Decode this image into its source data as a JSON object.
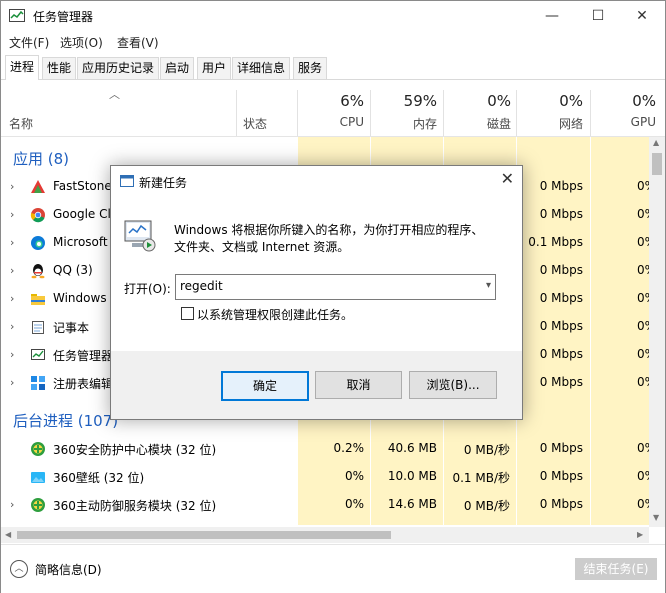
{
  "window": {
    "title": "任务管理器",
    "min": "—",
    "max": "☐",
    "close": "✕"
  },
  "menu": [
    "文件(F)",
    "选项(O)",
    "查看(V)"
  ],
  "tabs": [
    "进程",
    "性能",
    "应用历史记录",
    "启动",
    "用户",
    "详细信息",
    "服务"
  ],
  "columns": {
    "name": "名称",
    "status": "状态",
    "cpu": {
      "pct": "6%",
      "label": "CPU"
    },
    "mem": {
      "pct": "59%",
      "label": "内存"
    },
    "disk": {
      "pct": "0%",
      "label": "磁盘"
    },
    "net": {
      "pct": "0%",
      "label": "网络"
    },
    "gpu": {
      "pct": "0%",
      "label": "GPU"
    }
  },
  "groups": {
    "apps": "应用 (8)",
    "background": "后台进程 (107)"
  },
  "apps": [
    {
      "name": "FastStone",
      "net": "0 Mbps",
      "gpu": "0%",
      "icon": "faststone-icon"
    },
    {
      "name": "Google Cl",
      "net": "0 Mbps",
      "gpu": "0%",
      "icon": "chrome-icon"
    },
    {
      "name": "Microsoft",
      "net": "0.1 Mbps",
      "gpu": "0%",
      "icon": "edge-icon"
    },
    {
      "name": "QQ (3)",
      "net": "0 Mbps",
      "gpu": "0%",
      "icon": "qq-icon"
    },
    {
      "name": "Windows",
      "net": "0 Mbps",
      "gpu": "0%",
      "icon": "folder-icon"
    },
    {
      "name": "记事本",
      "net": "0 Mbps",
      "gpu": "0%",
      "icon": "notepad-icon"
    },
    {
      "name": "任务管理器",
      "net": "0 Mbps",
      "gpu": "0%",
      "icon": "taskmgr-icon"
    },
    {
      "name": "注册表编辑",
      "net": "0 Mbps",
      "gpu": "0%",
      "icon": "regedit-icon"
    }
  ],
  "background": [
    {
      "name": "360安全防护中心模块 (32 位)",
      "cpu": "0.2%",
      "mem": "40.6 MB",
      "disk": "0 MB/秒",
      "net": "0 Mbps",
      "gpu": "0%"
    },
    {
      "name": "360壁纸 (32 位)",
      "cpu": "0%",
      "mem": "10.0 MB",
      "disk": "0.1 MB/秒",
      "net": "0 Mbps",
      "gpu": "0%"
    },
    {
      "name": "360主动防御服务模块 (32 位)",
      "cpu": "0%",
      "mem": "14.6 MB",
      "disk": "0 MB/秒",
      "net": "0 Mbps",
      "gpu": "0%"
    }
  ],
  "status": {
    "details": "简略信息(D)",
    "end_task": "结束任务(E)"
  },
  "dialog": {
    "title": "新建任务",
    "desc1": "Windows 将根据你所键入的名称，为你打开相应的程序、",
    "desc2": "文件夹、文档或 Internet 资源。",
    "open_label": "打开(O):",
    "input_value": "regedit",
    "admin_label": "以系统管理权限创建此任务。",
    "ok": "确定",
    "cancel": "取消",
    "browse": "浏览(B)..."
  }
}
